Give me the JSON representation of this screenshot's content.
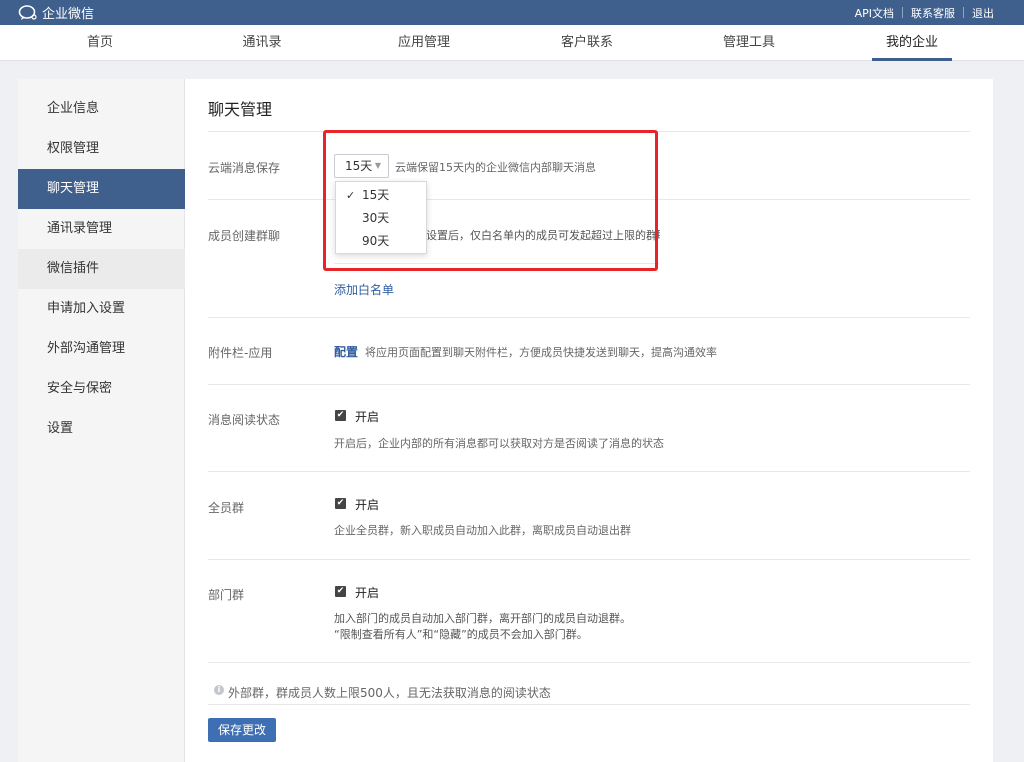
{
  "app": {
    "brand": "企业微信"
  },
  "top_links": [
    "API文档",
    "联系客服",
    "退出"
  ],
  "nav": [
    "首页",
    "通讯录",
    "应用管理",
    "客户联系",
    "管理工具",
    "我的企业"
  ],
  "sidebar": [
    "企业信息",
    "权限管理",
    "聊天管理",
    "通讯录管理",
    "微信插件",
    "申请加入设置",
    "外部沟通管理",
    "安全与保密",
    "设置"
  ],
  "page_title": "聊天管理",
  "cloud": {
    "label": "云端消息保存",
    "selected": "15天",
    "desc": "云端保留15天内的企业微信内部聊天消息",
    "options": [
      "15天",
      "30天",
      "90天"
    ]
  },
  "group_chat": {
    "label": "成员创建群聊",
    "desc": "设置后，仅白名单内的成员可发起超过上限的群聊",
    "link": "添加白名单"
  },
  "attach": {
    "label": "附件栏-应用",
    "link": "配置",
    "desc": "将应用页面配置到聊天附件栏，方便成员快捷发送到聊天，提高沟通效率"
  },
  "read_status": {
    "label": "消息阅读状态",
    "check_label": "开启",
    "desc": "开启后，企业内部的所有消息都可以获取对方是否阅读了消息的状态"
  },
  "all_group": {
    "label": "全员群",
    "check_label": "开启",
    "desc": "企业全员群，新入职成员自动加入此群，离职成员自动退出群"
  },
  "dept_group": {
    "label": "部门群",
    "check_label": "开启",
    "desc1": "加入部门的成员自动加入部门群，离开部门的成员自动退群。",
    "desc2": "“限制查看所有人”和“隐藏”的成员不会加入部门群。"
  },
  "external_note": "外部群，群成员人数上限500人，且无法获取消息的阅读状态",
  "save_label": "保存更改",
  "colors": {
    "header": "#3f5f8c",
    "accent_link": "#2f5d9e",
    "highlight": "#e8242b"
  }
}
